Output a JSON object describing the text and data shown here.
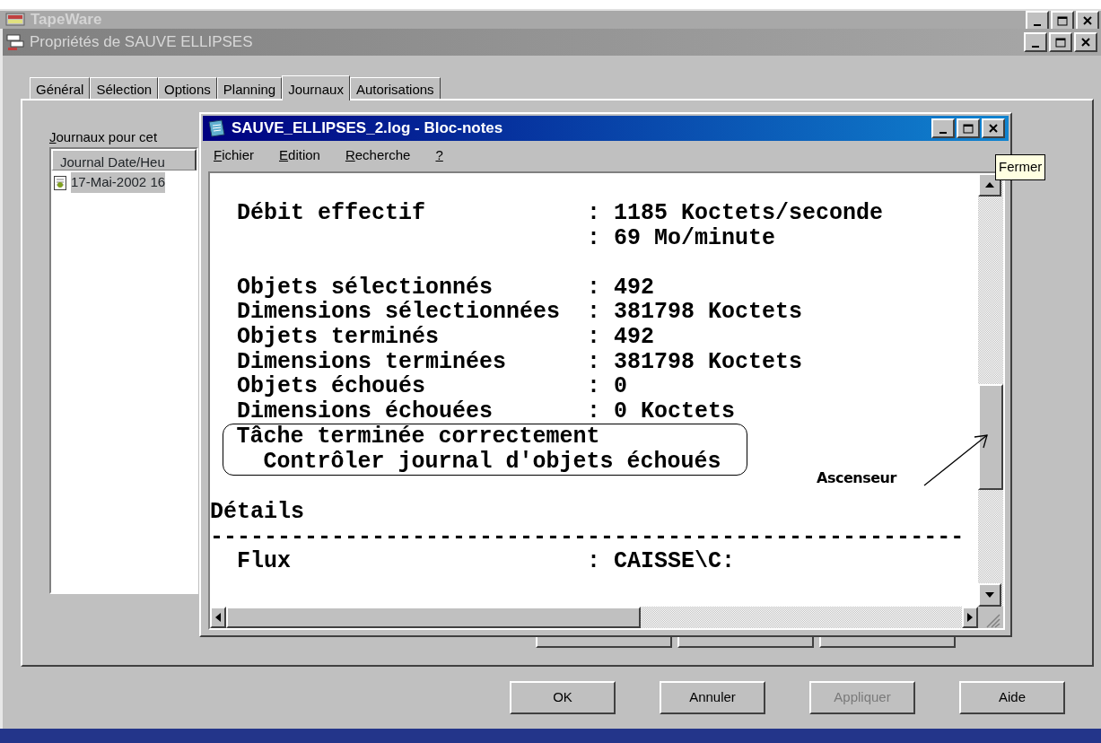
{
  "background_window": {
    "title": "TapeWare"
  },
  "properties_window": {
    "title": "Propriétés de SAUVE ELLIPSES",
    "active": false,
    "tabs": [
      {
        "label": "Général",
        "selected": false
      },
      {
        "label": "Sélection",
        "selected": false
      },
      {
        "label": "Options",
        "selected": false
      },
      {
        "label": "Planning",
        "selected": false
      },
      {
        "label": "Journaux",
        "selected": true
      },
      {
        "label": "Autorisations",
        "selected": false
      }
    ],
    "logs_label": {
      "text": "Journaux pour cet"
    },
    "logs_list": {
      "header": "Journal Date/Heu",
      "items": [
        {
          "text": "17-Mai-2002 16",
          "selected": true
        }
      ]
    },
    "buttons": [
      {
        "label": "OK",
        "disabled": false
      },
      {
        "label": "Annuler",
        "disabled": false
      },
      {
        "label": "Appliquer",
        "disabled": true
      },
      {
        "label": "Aide",
        "disabled": false
      }
    ]
  },
  "notepad": {
    "title": "SAUVE_ELLIPSES_2.log - Bloc-notes",
    "menu": [
      {
        "label": "Fichier"
      },
      {
        "label": "Edition"
      },
      {
        "label": "Recherche"
      },
      {
        "label": "?"
      }
    ],
    "log": [
      {
        "kind": "field",
        "label": "Débit effectif",
        "value": ": 1185 Koctets/seconde"
      },
      {
        "kind": "field",
        "value": ": 69 Mo/minute"
      },
      {
        "kind": "gap"
      },
      {
        "kind": "field",
        "label": "Objets sélectionnés",
        "value": ": 492"
      },
      {
        "kind": "field",
        "label": "Dimensions sélectionnées",
        "value": ": 381798 Koctets"
      },
      {
        "kind": "field",
        "label": "Objets terminés",
        "value": ": 492"
      },
      {
        "kind": "field",
        "label": "Dimensions terminées",
        "value": ": 381798 Koctets"
      },
      {
        "kind": "field",
        "label": "Objets échoués",
        "value": ": 0"
      },
      {
        "kind": "field",
        "label": "Dimensions échouées",
        "value": ": 0 Koctets"
      },
      {
        "kind": "note",
        "title": "Tâche terminée correctement",
        "detail": "Contrôler journal d'objets échoués"
      },
      {
        "kind": "gap"
      },
      {
        "kind": "heading",
        "text": "Détails"
      },
      {
        "kind": "rule",
        "text": "--------------------------------------------------------"
      },
      {
        "kind": "field",
        "label": "Flux",
        "value": ": CAISSE\\C:"
      }
    ],
    "annotation": {
      "label": "Ascenseur"
    },
    "tooltip": "Fermer"
  }
}
